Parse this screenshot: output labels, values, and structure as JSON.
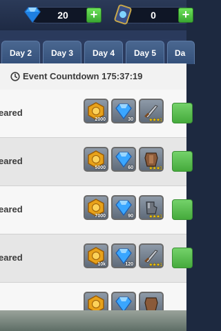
{
  "currencies": [
    {
      "name": "gems",
      "icon": "diamond-icon",
      "value": "20"
    },
    {
      "name": "tickets",
      "icon": "card-icon",
      "value": "0"
    }
  ],
  "tabs": [
    {
      "label": "Day 2"
    },
    {
      "label": "Day 3"
    },
    {
      "label": "Day 4"
    },
    {
      "label": "Day 5"
    },
    {
      "label": "Da"
    }
  ],
  "countdown": {
    "label": "Event Countdown 175:37:19"
  },
  "rows": [
    {
      "label": "eared",
      "rewards": {
        "coins": "2000",
        "gems": "30",
        "stars": "★★★1"
      }
    },
    {
      "label": "eared",
      "rewards": {
        "coins": "5000",
        "gems": "60",
        "stars": "★★★1"
      }
    },
    {
      "label": "eared",
      "rewards": {
        "coins": "7000",
        "gems": "90",
        "stars": "★★★1"
      }
    },
    {
      "label": "eared",
      "rewards": {
        "coins": "10k",
        "gems": "120",
        "stars": "★★★1"
      }
    },
    {
      "label": "",
      "rewards": {
        "coins": "",
        "gems": "",
        "stars": ""
      }
    }
  ],
  "colors": {
    "accent_green": "#45aa3c",
    "tab_blue": "#34507a",
    "header_bg": "#1e2a44"
  }
}
